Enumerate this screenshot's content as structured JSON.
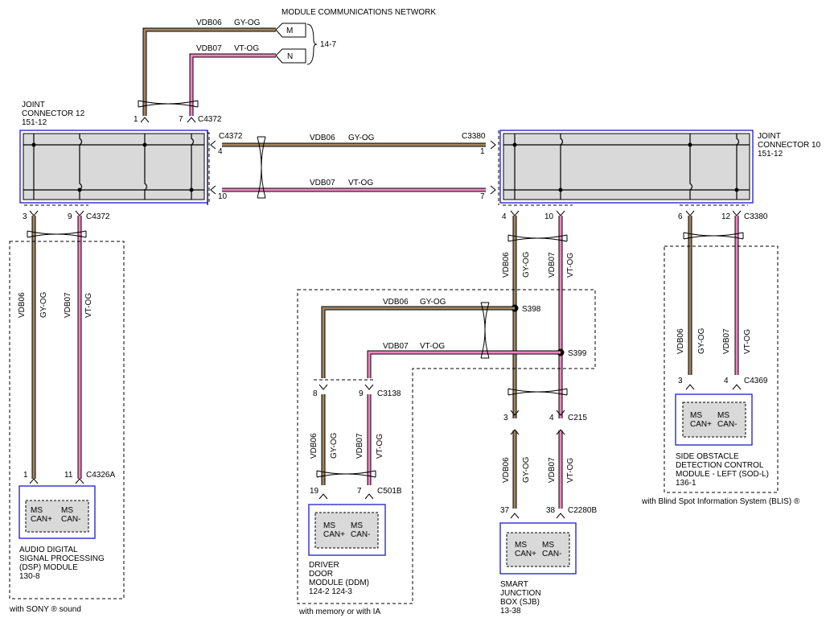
{
  "top": {
    "title": "MODULE COMMUNICATIONS NETWORK",
    "ref": "14-7",
    "m_label": "M",
    "n_label": "N"
  },
  "wires": {
    "w1": "VDB06",
    "w1c": "GY-OG",
    "w2": "VDB07",
    "w2c": "VT-OG"
  },
  "jc12": {
    "l1": "JOINT",
    "l2": "CONNECTOR 12",
    "l3": "151-12",
    "pin1": "1",
    "pin7": "7",
    "conn_top": "C4372",
    "conn_side": "C4372",
    "pin4": "4",
    "pin10": "10",
    "pin3": "3",
    "pin9": "9",
    "conn_bot": "C4372"
  },
  "jc10": {
    "l1": "JOINT",
    "l2": "CONNECTOR 10",
    "l3": "151-12",
    "conn_side": "C3380",
    "pin1": "1",
    "pin7": "7",
    "pin4": "4",
    "pin10": "10",
    "pin6": "6",
    "pin12": "12",
    "conn_bot": "C3380"
  },
  "dsp": {
    "pin1": "1",
    "pin11": "11",
    "conn": "C4326A",
    "ms1": "MS",
    "can1": "CAN+",
    "ms2": "MS",
    "can2": "CAN-",
    "n1": "AUDIO DIGITAL",
    "n2": "SIGNAL PROCESSING",
    "n3": "(DSP) MODULE",
    "n4": "130-8",
    "note": "with SONY ® sound"
  },
  "ddm": {
    "pin8": "8",
    "pin9": "9",
    "conn_top": "C3138",
    "pin19": "19",
    "pin7": "7",
    "conn": "C501B",
    "ms1": "MS",
    "can1": "CAN+",
    "ms2": "MS",
    "can2": "CAN-",
    "n1": "DRIVER",
    "n2": "DOOR",
    "n3": "MODULE (DDM)",
    "n4": "124-2   124-3",
    "note": "with memory or with IA",
    "s398": "S398",
    "s399": "S399"
  },
  "sjb": {
    "pin3": "3",
    "pin4": "4",
    "conn_mid": "C215",
    "pin37": "37",
    "pin38": "38",
    "conn": "C2280B",
    "ms1": "MS",
    "can1": "CAN+",
    "ms2": "MS",
    "can2": "CAN-",
    "n1": "SMART",
    "n2": "JUNCTION",
    "n3": "BOX (SJB)",
    "n4": "13-38"
  },
  "sod": {
    "pin3": "3",
    "pin4": "4",
    "conn": "C4369",
    "ms1": "MS",
    "can1": "CAN+",
    "ms2": "MS",
    "can2": "CAN-",
    "n1": "SIDE OBSTACLE",
    "n2": "DETECTION CONTROL",
    "n3": "MODULE - LEFT (SOD-L)",
    "n4": "136-1",
    "note": "with Blind Spot Information System (BLIS) ®"
  },
  "colors": {
    "gy_og": "#a08660",
    "vt_og": "#ef86bf",
    "module_border": "#2b2bd0"
  }
}
